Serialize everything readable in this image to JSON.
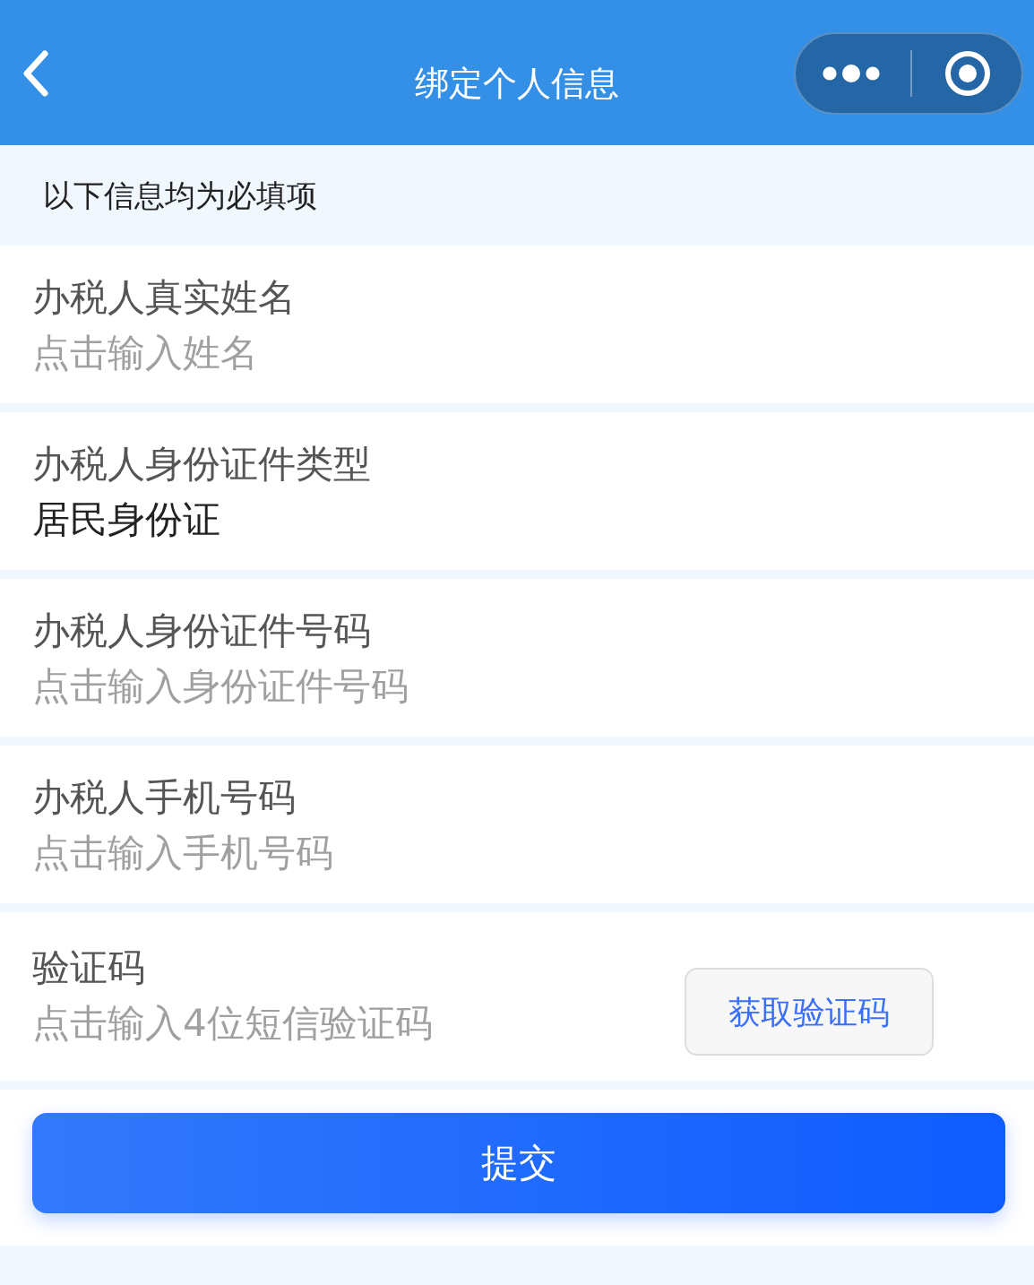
{
  "window": {
    "title": "绑定个人信息"
  },
  "notice": "以下信息均为必填项",
  "fields": [
    {
      "label": "办税人真实姓名",
      "placeholder": "点击输入姓名"
    },
    {
      "label": "办税人身份证件类型",
      "value": "居民身份证"
    },
    {
      "label": "办税人身份证件号码",
      "placeholder": "点击输入身份证件号码"
    },
    {
      "label": "办税人手机号码",
      "placeholder": "点击输入手机号码"
    },
    {
      "label": "验证码",
      "placeholder": "点击输入4位短信验证码",
      "action": "获取验证码"
    }
  ],
  "submit": "提交"
}
